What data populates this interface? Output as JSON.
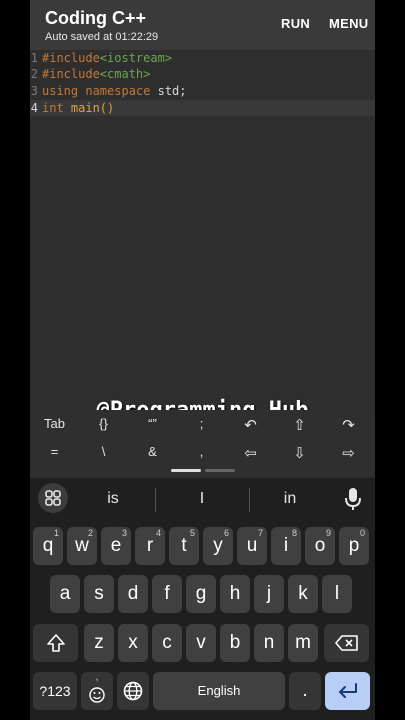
{
  "header": {
    "title": "Coding C++",
    "subtitle": "Auto saved at 01:22:29",
    "run_label": "RUN",
    "menu_label": "MENU"
  },
  "editor": {
    "lines": [
      {
        "num": "1",
        "a": "#include",
        "b": "<iostream>"
      },
      {
        "num": "2",
        "a": "#include",
        "b": "<cmath>"
      },
      {
        "num": "3",
        "a": "using namespace",
        "b": " std;"
      },
      {
        "num": "4",
        "a": "int",
        "b": " main()"
      }
    ],
    "active_line": 4,
    "watermark": "@Programming_Hub"
  },
  "extra_keys": {
    "row1": [
      "Tab",
      "{}",
      "“”",
      ";",
      "↶",
      "⇧",
      "↷"
    ],
    "row2": [
      "=",
      "\\",
      "&",
      ",",
      "⇦",
      "⇩",
      "⇨"
    ]
  },
  "suggestions": [
    "is",
    "I",
    "in"
  ],
  "keyboard": {
    "row1": [
      {
        "k": "q",
        "h": "1"
      },
      {
        "k": "w",
        "h": "2"
      },
      {
        "k": "e",
        "h": "3"
      },
      {
        "k": "r",
        "h": "4"
      },
      {
        "k": "t",
        "h": "5"
      },
      {
        "k": "y",
        "h": "6"
      },
      {
        "k": "u",
        "h": "7"
      },
      {
        "k": "i",
        "h": "8"
      },
      {
        "k": "o",
        "h": "9"
      },
      {
        "k": "p",
        "h": "0"
      }
    ],
    "row2": [
      "a",
      "s",
      "d",
      "f",
      "g",
      "h",
      "j",
      "k",
      "l"
    ],
    "row3": [
      "z",
      "x",
      "c",
      "v",
      "b",
      "n",
      "m"
    ],
    "symbols_label": "?123",
    "emoji_hint": ",",
    "space_label": "English",
    "period_label": "."
  },
  "colors": {
    "background": "#2b2b2b",
    "header": "#3a3a3a",
    "preprocessor": "#c07a3a",
    "include_target": "#6aa84f",
    "function": "#d9a441",
    "enter_key": "#b8cef5"
  }
}
